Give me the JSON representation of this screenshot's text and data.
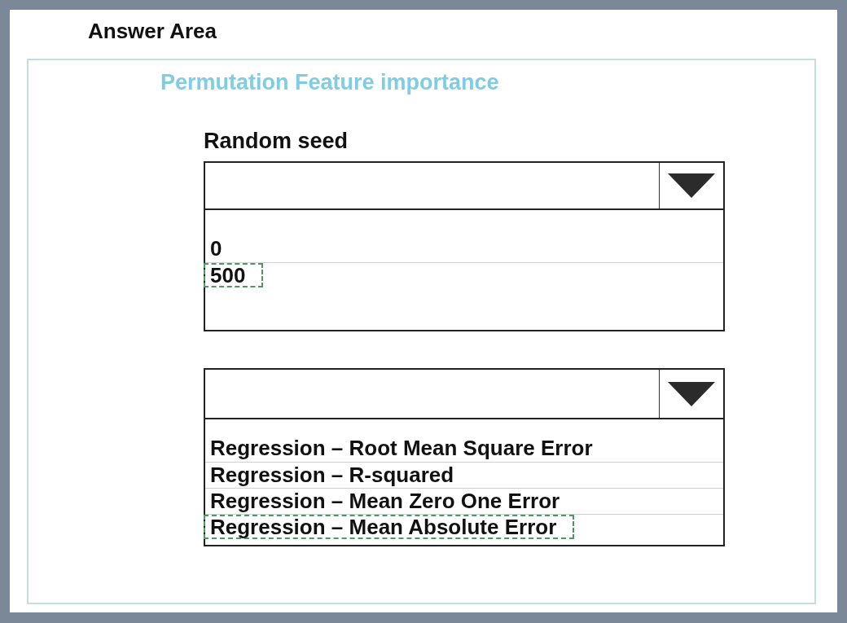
{
  "heading": "Answer Area",
  "panel": {
    "title": "Permutation Feature importance",
    "dropdowns": [
      {
        "label": "Random seed",
        "options": [
          {
            "text": "0",
            "selected": false
          },
          {
            "text": "500",
            "selected": true
          }
        ]
      },
      {
        "options": [
          {
            "text": "Regression – Root Mean Square Error",
            "selected": false
          },
          {
            "text": "Regression – R-squared",
            "selected": false
          },
          {
            "text": "Regression – Mean Zero One Error",
            "selected": false
          },
          {
            "text": "Regression – Mean Absolute Error",
            "selected": true
          }
        ]
      }
    ]
  }
}
